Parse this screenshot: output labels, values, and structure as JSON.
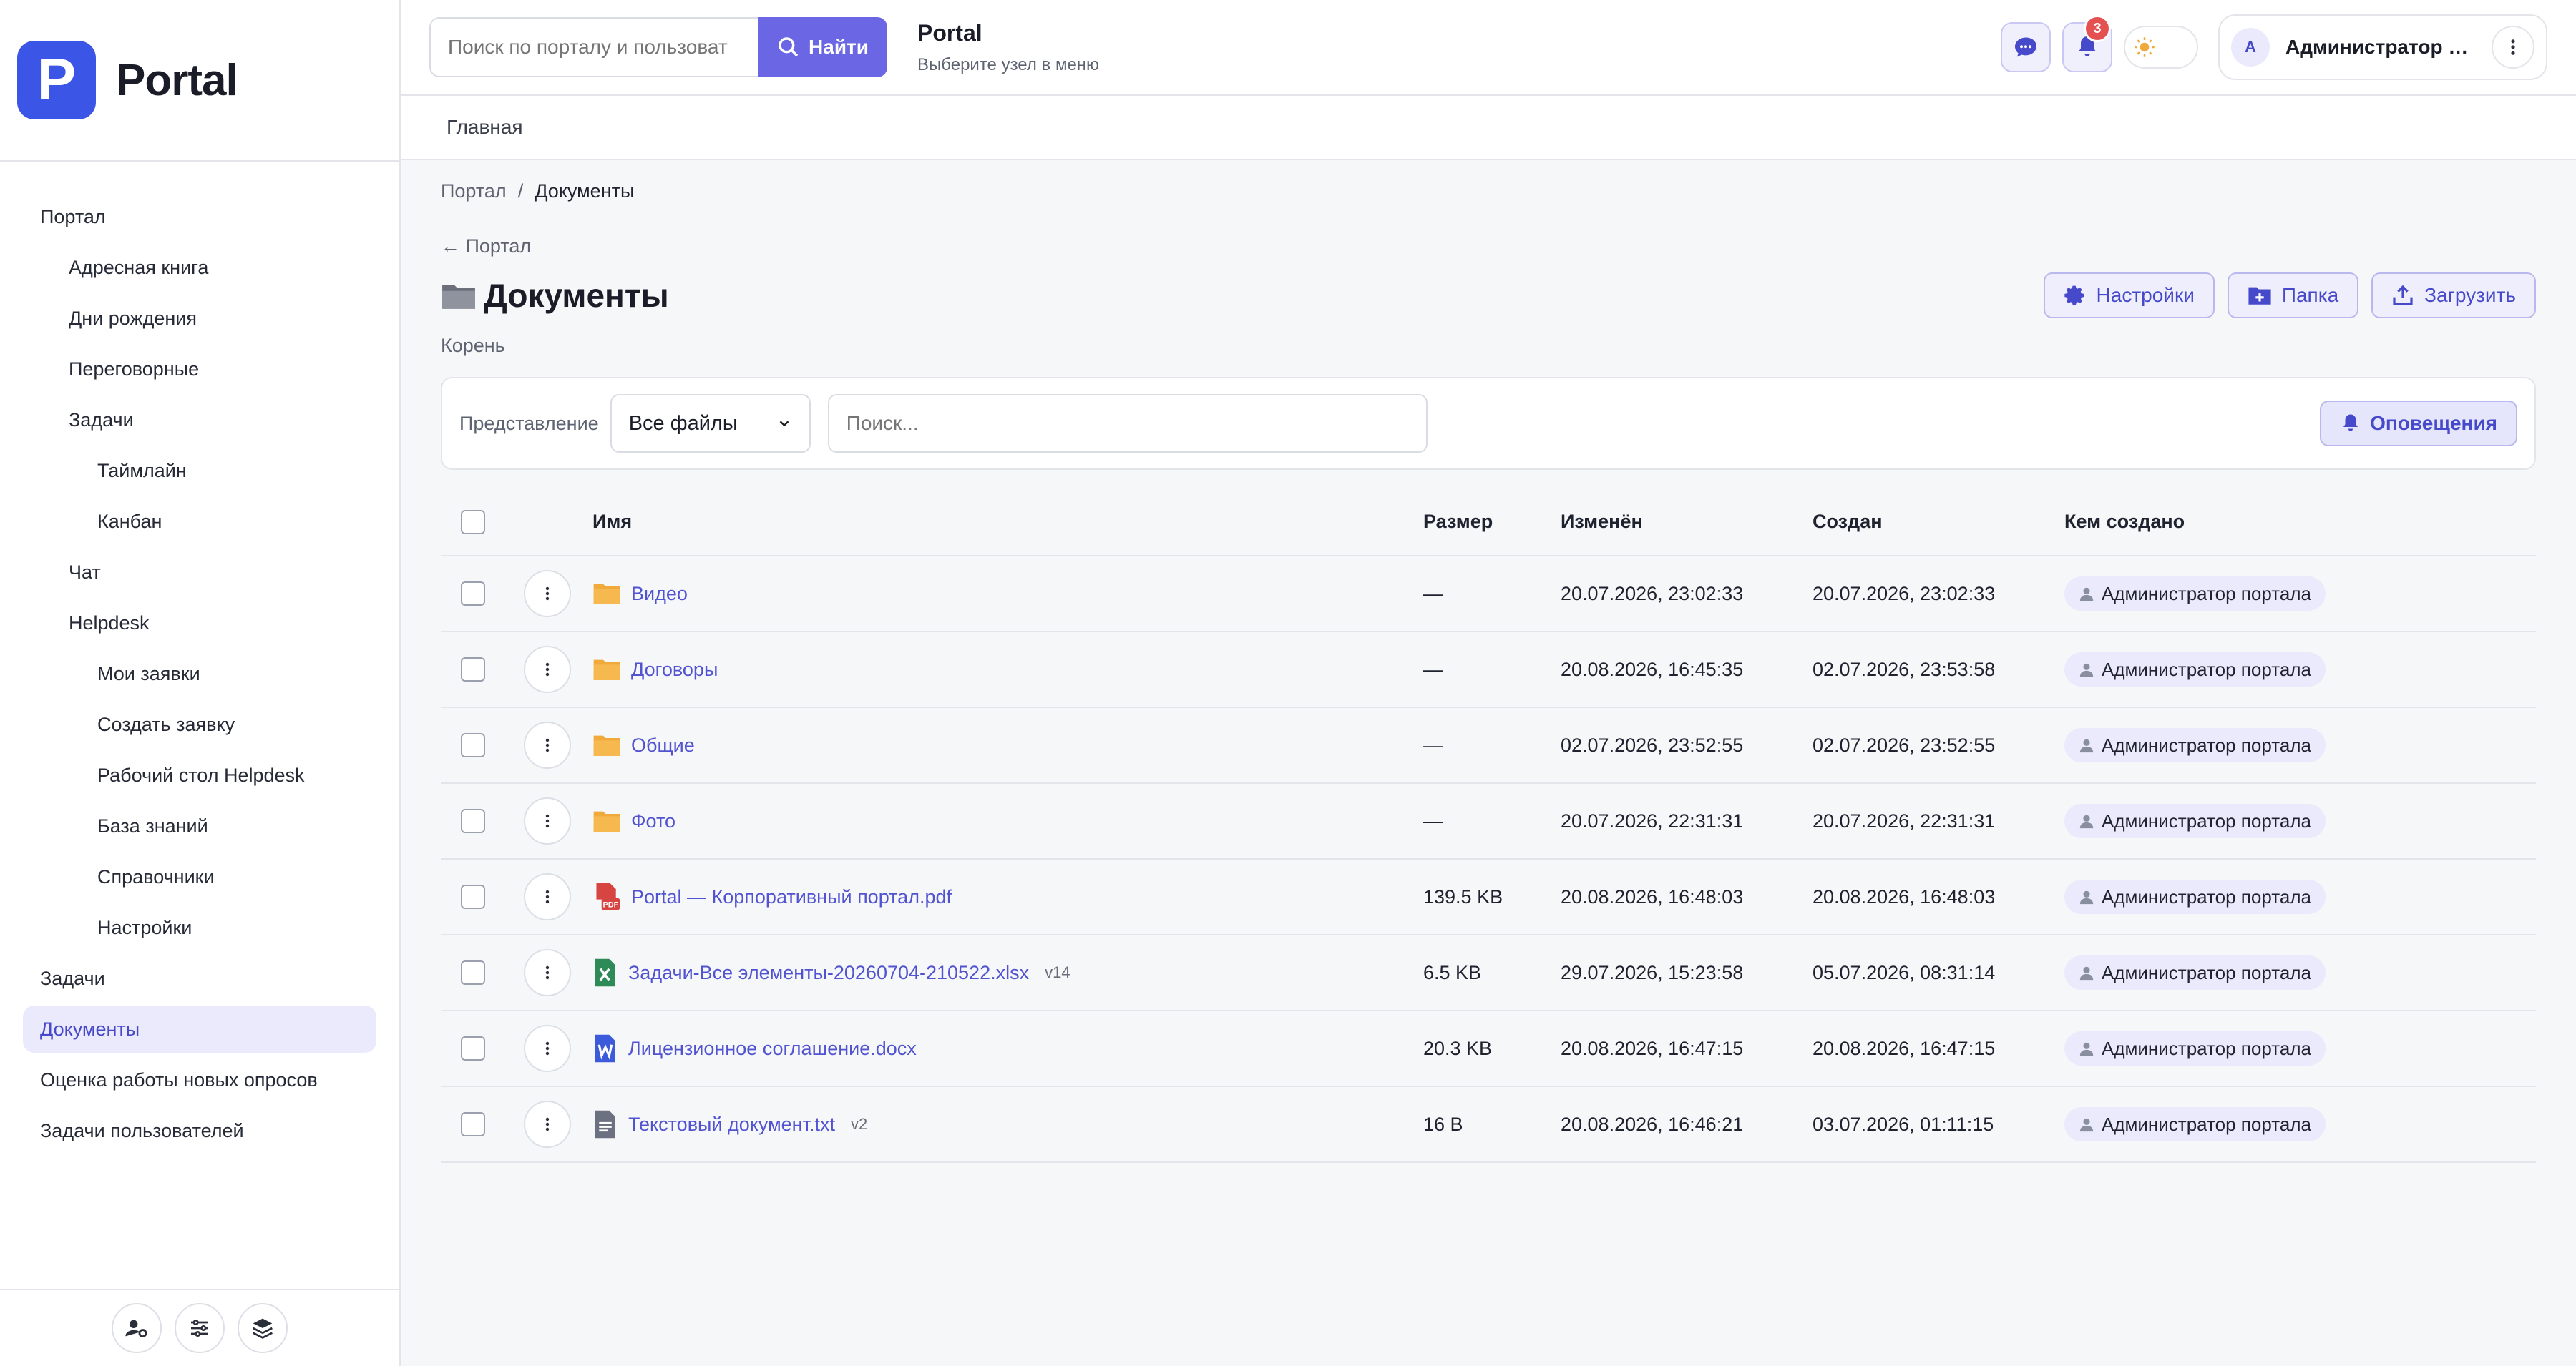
{
  "brand": {
    "logo_letter": "P",
    "name": "Portal"
  },
  "sidebar": {
    "items": [
      {
        "label": "Портал",
        "level": 0
      },
      {
        "label": "Адресная книга",
        "level": 1
      },
      {
        "label": "Дни рождения",
        "level": 1
      },
      {
        "label": "Переговорные",
        "level": 1
      },
      {
        "label": "Задачи",
        "level": 1
      },
      {
        "label": "Таймлайн",
        "level": 2
      },
      {
        "label": "Канбан",
        "level": 2
      },
      {
        "label": "Чат",
        "level": 1
      },
      {
        "label": "Helpdesk",
        "level": 1
      },
      {
        "label": "Мои заявки",
        "level": 2
      },
      {
        "label": "Создать заявку",
        "level": 2
      },
      {
        "label": "Рабочий стол Helpdesk",
        "level": 2
      },
      {
        "label": "База знаний",
        "level": 2
      },
      {
        "label": "Справочники",
        "level": 2
      },
      {
        "label": "Настройки",
        "level": 2
      },
      {
        "label": "Задачи",
        "level": 0
      },
      {
        "label": "Документы",
        "level": 0,
        "active": true
      },
      {
        "label": "Оценка работы новых опросов",
        "level": 0
      },
      {
        "label": "Задачи пользователей",
        "level": 0
      }
    ],
    "footer_icons": [
      "user-settings-icon",
      "sliders-icon",
      "layers-icon"
    ]
  },
  "topbar": {
    "search_placeholder": "Поиск по порталу и пользоват",
    "search_button": "Найти",
    "title": "Portal",
    "subtitle": "Выберите узел в меню",
    "notifications_count": "3",
    "user_initial": "A",
    "user_name": "Администратор портала"
  },
  "subbar": {
    "label": "Главная"
  },
  "breadcrumb": {
    "root": "Портал",
    "sep": "/",
    "current": "Документы"
  },
  "back_link": "← Портал",
  "page": {
    "title": "Документы",
    "settings_button": "Настройки",
    "folder_button": "Папка",
    "upload_button": "Загрузить",
    "root_label": "Корень"
  },
  "filters": {
    "view_label": "Представление",
    "view_value": "Все файлы",
    "search_placeholder": "Поиск...",
    "notify_button": "Оповещения"
  },
  "table": {
    "headers": {
      "name": "Имя",
      "size": "Размер",
      "modified": "Изменён",
      "created": "Создан",
      "author": "Кем создано"
    },
    "rows": [
      {
        "type": "folder",
        "name": "Видео",
        "version": "",
        "size": "—",
        "modified": "20.07.2026, 23:02:33",
        "created": "20.07.2026, 23:02:33",
        "author": "Администратор портала"
      },
      {
        "type": "folder",
        "name": "Договоры",
        "version": "",
        "size": "—",
        "modified": "20.08.2026, 16:45:35",
        "created": "02.07.2026, 23:53:58",
        "author": "Администратор портала"
      },
      {
        "type": "folder",
        "name": "Общие",
        "version": "",
        "size": "—",
        "modified": "02.07.2026, 23:52:55",
        "created": "02.07.2026, 23:52:55",
        "author": "Администратор портала"
      },
      {
        "type": "folder",
        "name": "Фото",
        "version": "",
        "size": "—",
        "modified": "20.07.2026, 22:31:31",
        "created": "20.07.2026, 22:31:31",
        "author": "Администратор портала"
      },
      {
        "type": "pdf",
        "name": "Portal — Корпоративный портал.pdf",
        "version": "",
        "size": "139.5 KB",
        "modified": "20.08.2026, 16:48:03",
        "created": "20.08.2026, 16:48:03",
        "author": "Администратор портала"
      },
      {
        "type": "xlsx",
        "name": "Задачи-Все элементы-20260704-210522.xlsx",
        "version": "v14",
        "size": "6.5 KB",
        "modified": "29.07.2026, 15:23:58",
        "created": "05.07.2026, 08:31:14",
        "author": "Администратор портала"
      },
      {
        "type": "docx",
        "name": "Лицензионное соглашение.docx",
        "version": "",
        "size": "20.3 KB",
        "modified": "20.08.2026, 16:47:15",
        "created": "20.08.2026, 16:47:15",
        "author": "Администратор портала"
      },
      {
        "type": "txt",
        "name": "Текстовый документ.txt",
        "version": "v2",
        "size": "16 B",
        "modified": "20.08.2026, 16:46:21",
        "created": "03.07.2026, 01:11:15",
        "author": "Администратор портала"
      }
    ]
  },
  "colors": {
    "accent": "#6a66e4",
    "brand": "#3b55e6",
    "folder": "#f0a93b",
    "pdf": "#d64541",
    "xlsx": "#2e8b57",
    "docx": "#3b5bdb",
    "txt": "#6b7180",
    "badge": "#e55050"
  }
}
